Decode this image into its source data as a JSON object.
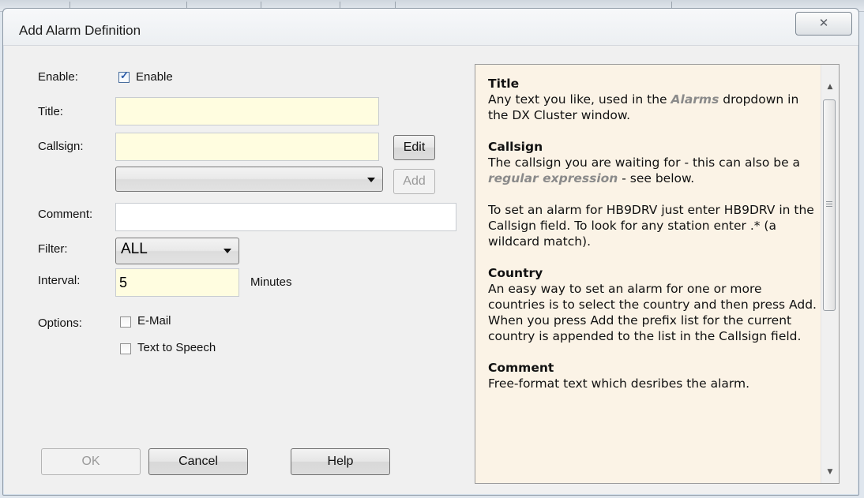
{
  "window": {
    "title": "Add Alarm Definition",
    "close_glyph": "✕"
  },
  "form": {
    "enable_label": "Enable:",
    "enable_checkbox_label": "Enable",
    "enable_checked": true,
    "title_label": "Title:",
    "title_value": "",
    "callsign_label": "Callsign:",
    "callsign_value": "",
    "edit_button": "Edit",
    "country_select_value": "",
    "add_button": "Add",
    "comment_label": "Comment:",
    "comment_value": "",
    "filter_label": "Filter:",
    "filter_value": "ALL",
    "interval_label": "Interval:",
    "interval_value": "5",
    "interval_unit": "Minutes",
    "options_label": "Options:",
    "email_label": "E-Mail",
    "email_checked": false,
    "tts_label": "Text to Speech",
    "tts_checked": false
  },
  "buttons": {
    "ok": "OK",
    "cancel": "Cancel",
    "help": "Help"
  },
  "help": {
    "title_heading": "Title",
    "title_text_a": "Any text you like, used in the ",
    "title_term": "Alarms",
    "title_text_b": " dropdown in the DX Cluster window.",
    "callsign_heading": "Callsign",
    "callsign_text_a": "The callsign you are waiting for - this can also be a ",
    "callsign_term": "regular expression",
    "callsign_text_b": " - see below.",
    "callsign_para2": "To set an alarm for HB9DRV just enter HB9DRV in the Callsign field. To look for any station enter .* (a wildcard match).",
    "country_heading": "Country",
    "country_text": "An easy way to set an alarm for one or more countries is to select the country and then press Add. When you press Add the prefix list for the current country is appended to the list in the Callsign field.",
    "comment_heading": "Comment",
    "comment_text": "Free-format text which desribes the alarm."
  },
  "icons": {
    "scroll_up": "▲",
    "scroll_down": "▼",
    "checkmark": "✓"
  }
}
